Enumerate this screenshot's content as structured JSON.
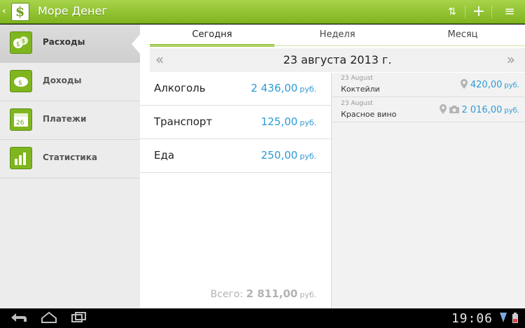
{
  "app": {
    "title": "Море Денег"
  },
  "actionbar": {
    "icons": [
      "back-chevron-icon",
      "app-logo-icon",
      "sort-icon",
      "add-icon",
      "menu-icon"
    ],
    "add_label": "+",
    "sort_label": "⇅",
    "menu_label": "≡"
  },
  "sidebar": {
    "items": [
      {
        "label": "Расходы",
        "icon": "expenses-icon",
        "active": true
      },
      {
        "label": "Доходы",
        "icon": "income-icon",
        "active": false
      },
      {
        "label": "Платежи",
        "icon": "calendar-icon",
        "active": false
      },
      {
        "label": "Статистика",
        "icon": "statistics-icon",
        "active": false
      }
    ],
    "calendar_day": "26"
  },
  "tabs": [
    {
      "label": "Сегодня",
      "active": true
    },
    {
      "label": "Неделя",
      "active": false
    },
    {
      "label": "Месяц",
      "active": false
    }
  ],
  "datebar": {
    "date": "23 августа 2013 г.",
    "prev": "«",
    "next": "»"
  },
  "categories": [
    {
      "name": "Алкоголь",
      "amount": "2 436,00",
      "currency": "руб."
    },
    {
      "name": "Транспорт",
      "amount": "125,00",
      "currency": "руб."
    },
    {
      "name": "Еда",
      "amount": "250,00",
      "currency": "руб."
    }
  ],
  "total": {
    "label": "Всего:",
    "amount": "2 811,00",
    "currency": "руб."
  },
  "details": [
    {
      "date": "23 August",
      "name": "Коктейли",
      "amount": "420,00",
      "currency": "руб.",
      "icons": [
        "location-icon"
      ]
    },
    {
      "date": "23 August",
      "name": "Красное вино",
      "amount": "2 016,00",
      "currency": "руб.",
      "icons": [
        "location-icon",
        "camera-icon"
      ]
    }
  ],
  "system": {
    "clock": "19:06"
  },
  "colors": {
    "accent": "#8cc133",
    "amount": "#2f9ad6"
  }
}
